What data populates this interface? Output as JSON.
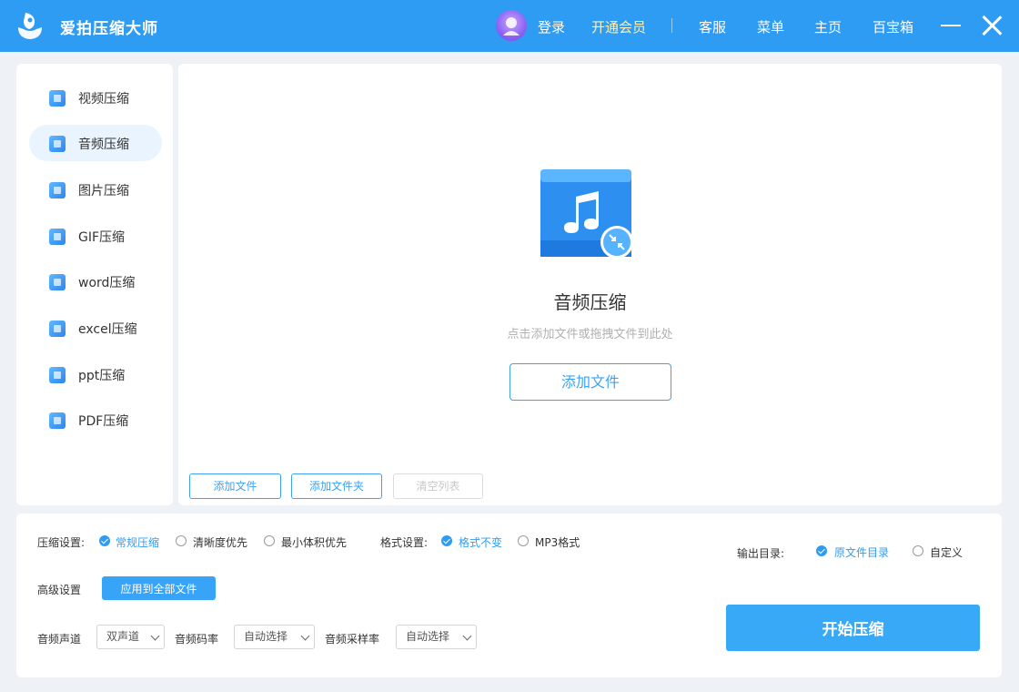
{
  "window": {
    "title": "爱拍压缩大师",
    "nav": {
      "login": "登录",
      "vip": "开通会员",
      "support": "客服",
      "menu": "菜单",
      "home": "主页",
      "toolbox": "百宝箱"
    }
  },
  "sidebar": {
    "items": [
      {
        "label": "视频压缩",
        "icon": "video-file-icon"
      },
      {
        "label": "音频压缩",
        "icon": "audio-file-icon",
        "active": true
      },
      {
        "label": "图片压缩",
        "icon": "image-file-icon"
      },
      {
        "label": "GIF压缩",
        "icon": "gif-file-icon"
      },
      {
        "label": "word压缩",
        "icon": "word-file-icon"
      },
      {
        "label": "excel压缩",
        "icon": "excel-file-icon"
      },
      {
        "label": "ppt压缩",
        "icon": "ppt-file-icon"
      },
      {
        "label": "PDF压缩",
        "icon": "pdf-file-icon"
      }
    ]
  },
  "dropzone": {
    "title": "音频压缩",
    "hint": "点击添加文件或拖拽文件到此处",
    "add_file": "添加文件",
    "toolbar": {
      "add_file": "添加文件",
      "add_folder": "添加文件夹",
      "clear_list": "清空列表"
    }
  },
  "settings": {
    "compress_label": "压缩设置:",
    "compress_options": [
      "常规压缩",
      "清晰度优先",
      "最小体积优先"
    ],
    "compress_selected": 0,
    "format_label": "格式设置:",
    "format_options": [
      "格式不变",
      "MP3格式"
    ],
    "format_selected": 0,
    "output_label": "输出目录:",
    "output_options": [
      "原文件目录",
      "自定义"
    ],
    "output_selected": 0,
    "advanced_label": "高级设置",
    "apply_all": "应用到全部文件",
    "channel_label": "音频声道",
    "channel_value": "双声道",
    "bitrate_label": "音频码率",
    "bitrate_value": "自动选择",
    "samplerate_label": "音频采样率",
    "samplerate_value": "自动选择",
    "start": "开始压缩"
  },
  "colors": {
    "primary": "#2f9cf4",
    "start_button": "#37a9f7",
    "vip_text": "#fff0b3"
  }
}
